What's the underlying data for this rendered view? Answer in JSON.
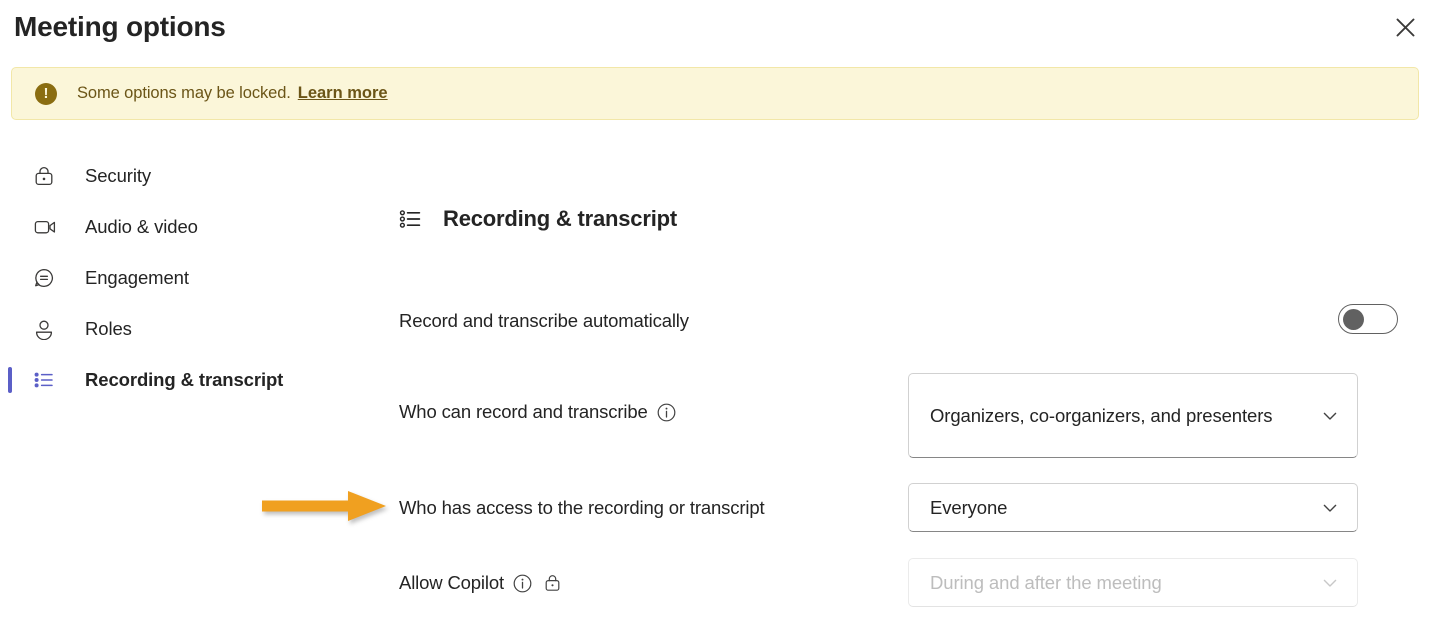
{
  "header": {
    "title": "Meeting options",
    "close_icon": "close-icon"
  },
  "banner": {
    "icon": "warning-filled-icon",
    "text": "Some options may be locked.",
    "link_label": "Learn more",
    "background_color": "#fbf6d9",
    "border_color": "#f2e7a8",
    "text_color": "#6b5517"
  },
  "sidebar": {
    "accent_color": "#5b5fc7",
    "items": [
      {
        "label": "Security",
        "icon": "lock-icon",
        "selected": false
      },
      {
        "label": "Audio & video",
        "icon": "video-camera-icon",
        "selected": false
      },
      {
        "label": "Engagement",
        "icon": "chat-bubble-icon",
        "selected": false
      },
      {
        "label": "Roles",
        "icon": "person-icon",
        "selected": false
      },
      {
        "label": "Recording & transcript",
        "icon": "task-list-icon",
        "selected": true
      }
    ]
  },
  "main": {
    "section": {
      "icon": "task-list-icon",
      "title": "Recording & transcript"
    },
    "rows": [
      {
        "label": "Record and transcribe automatically",
        "control": "toggle",
        "toggle_on": false
      },
      {
        "label": "Who can record and transcribe",
        "has_info_icon": true,
        "control": "dropdown",
        "value": "Organizers, co-organizers, and presenters",
        "disabled": false
      },
      {
        "label": "Who has access to the recording or transcript",
        "has_info_icon": false,
        "control": "dropdown",
        "value": "Everyone",
        "disabled": false,
        "annotated": true
      },
      {
        "label": "Allow Copilot",
        "has_info_icon": true,
        "has_lock_icon": true,
        "control": "dropdown",
        "value": "During and after the meeting",
        "disabled": true
      }
    ]
  },
  "annotation": {
    "type": "arrow",
    "color": "#f0a020",
    "points_to": "Who has access to the recording or transcript"
  }
}
